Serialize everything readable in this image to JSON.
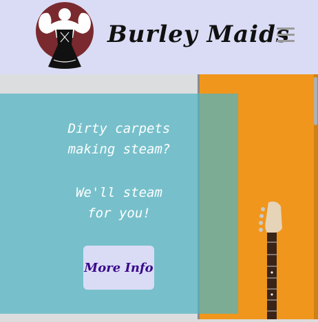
{
  "header": {
    "brand": "Burley Maids"
  },
  "hero": {
    "line1": "Dirty carpets",
    "line2": "making steam?",
    "line3": "We'll steam",
    "line4": "for you!",
    "button_label": "More Info"
  },
  "colors": {
    "header_bg": "#dadcf5",
    "panel": "#50b4c3",
    "orange": "#f0961c",
    "button_text": "#3a0a8a",
    "logo_circle": "#7a2a2e"
  },
  "icons": {
    "logo": "strongwoman-logo-icon",
    "menu": "hamburger-menu-icon",
    "guitar": "guitar-icon"
  }
}
